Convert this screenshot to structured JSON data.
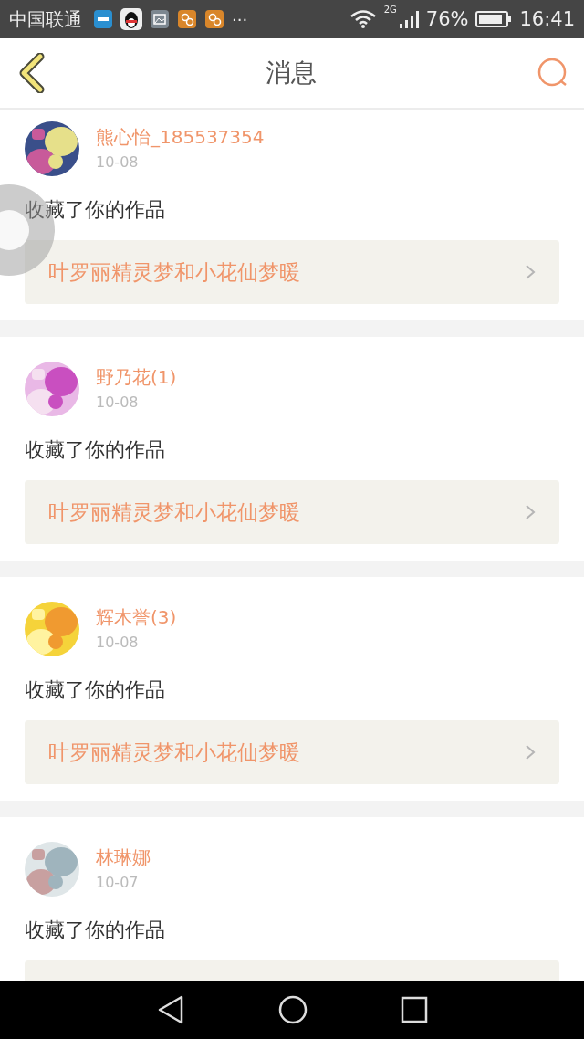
{
  "status_bar": {
    "carrier": "中国联通",
    "more": "···",
    "network": "2G",
    "battery": "76%",
    "time": "16:41"
  },
  "header": {
    "title": "消息"
  },
  "messages": [
    {
      "user": "熊心怡_185537354",
      "date": "10-08",
      "text": "收藏了你的作品",
      "work": "叶罗丽精灵梦和小花仙梦暖"
    },
    {
      "user": "野乃花(1)",
      "date": "10-08",
      "text": "收藏了你的作品",
      "work": "叶罗丽精灵梦和小花仙梦暖"
    },
    {
      "user": "辉木誉(3)",
      "date": "10-08",
      "text": "收藏了你的作品",
      "work": "叶罗丽精灵梦和小花仙梦暖"
    },
    {
      "user": "林琳娜",
      "date": "10-07",
      "text": "收藏了你的作品"
    }
  ]
}
